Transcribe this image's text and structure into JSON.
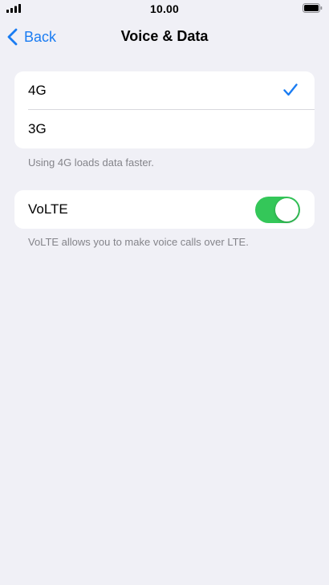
{
  "status_bar": {
    "time": "10.00",
    "signal_icon": "cellular-signal-icon",
    "battery_icon": "battery-icon"
  },
  "nav": {
    "back_label": "Back",
    "title": "Voice & Data"
  },
  "network": {
    "options": [
      {
        "label": "4G",
        "selected": true
      },
      {
        "label": "3G",
        "selected": false
      }
    ],
    "footnote": "Using 4G loads data faster."
  },
  "volte": {
    "label": "VoLTE",
    "enabled": true,
    "footnote": "VoLTE allows you to make voice calls over LTE."
  },
  "colors": {
    "accent": "#1a7cf2",
    "toggle_on": "#34c759",
    "background": "#f0f0f6"
  }
}
